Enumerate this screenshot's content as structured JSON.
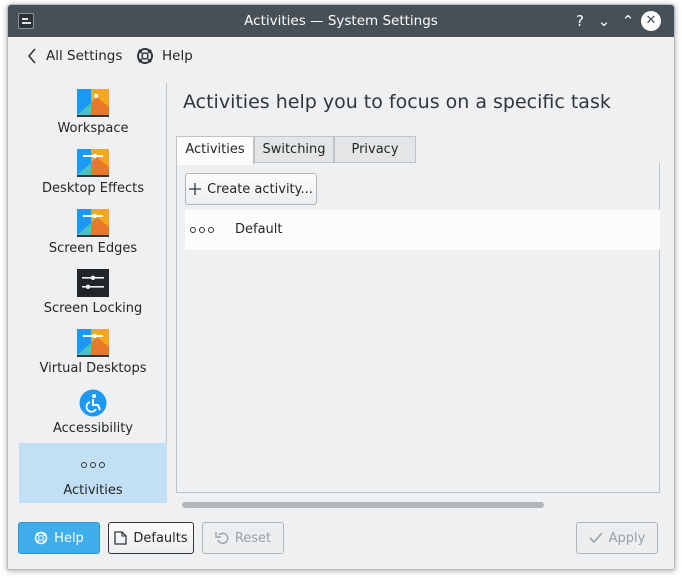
{
  "window": {
    "title": "Activities — System Settings"
  },
  "titlebar": {
    "help_glyph": "?",
    "minimize_glyph": "⌄",
    "maximize_glyph": "⌃",
    "close_glyph": "✕"
  },
  "toolbar": {
    "back_label": "All Settings",
    "help_label": "Help"
  },
  "sidebar": {
    "items": [
      {
        "label": "Workspace",
        "icon": "workspace-icon"
      },
      {
        "label": "Desktop Effects",
        "icon": "desktop-effects-icon"
      },
      {
        "label": "Screen Edges",
        "icon": "screen-edges-icon"
      },
      {
        "label": "Screen Locking",
        "icon": "screen-locking-icon"
      },
      {
        "label": "Virtual Desktops",
        "icon": "virtual-desktops-icon"
      },
      {
        "label": "Accessibility",
        "icon": "accessibility-icon"
      },
      {
        "label": "Activities",
        "icon": "activities-icon"
      }
    ],
    "active": "Activities"
  },
  "main": {
    "heading": "Activities help you to focus on a specific task",
    "tabs": [
      {
        "label": "Activities"
      },
      {
        "label": "Switching"
      },
      {
        "label": "Privacy"
      }
    ],
    "create_button": "Create activity...",
    "activities": [
      {
        "name": "Default"
      }
    ]
  },
  "footer": {
    "help": "Help",
    "defaults": "Defaults",
    "reset": "Reset",
    "apply": "Apply"
  },
  "colors": {
    "accent": "#3daee9",
    "titlebar": "#475057",
    "selection": "#c2e0f5",
    "window_bg": "#eff0f1"
  }
}
